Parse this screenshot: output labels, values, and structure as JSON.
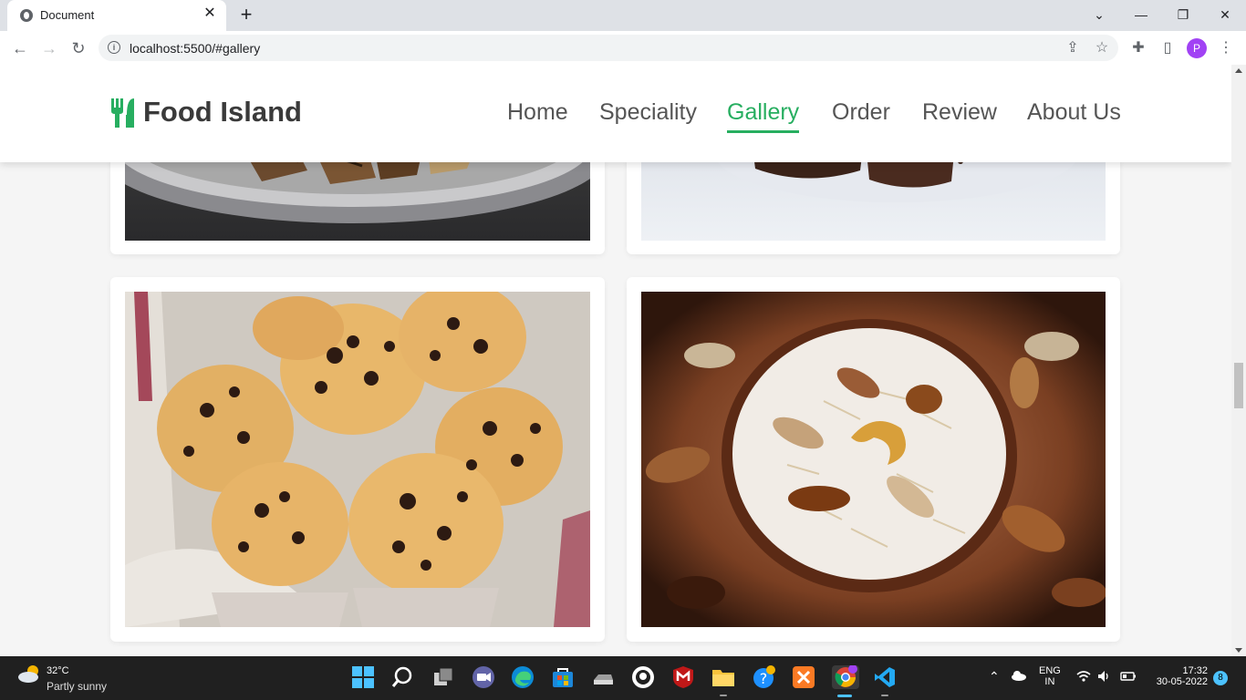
{
  "browser": {
    "tab_title": "Document",
    "url": "localhost:5500/#gallery",
    "profile_initial": "P"
  },
  "site": {
    "brand": "Food Island",
    "nav": [
      {
        "label": "Home"
      },
      {
        "label": "Speciality"
      },
      {
        "label": "Gallery",
        "active": true
      },
      {
        "label": "Order"
      },
      {
        "label": "Review"
      },
      {
        "label": "About Us"
      }
    ],
    "accent_color": "#27ae60",
    "gallery": [
      {
        "name": "grilled-dish-photo"
      },
      {
        "name": "chocolate-dessert-photo"
      },
      {
        "name": "chocolate-chip-muffins-photo"
      },
      {
        "name": "vermicelli-kheer-photo"
      }
    ]
  },
  "taskbar": {
    "weather_temp": "32°C",
    "weather_condition": "Partly sunny",
    "language_line1": "ENG",
    "language_line2": "IN",
    "time": "17:32",
    "date": "30-05-2022",
    "notification_count": "8"
  }
}
